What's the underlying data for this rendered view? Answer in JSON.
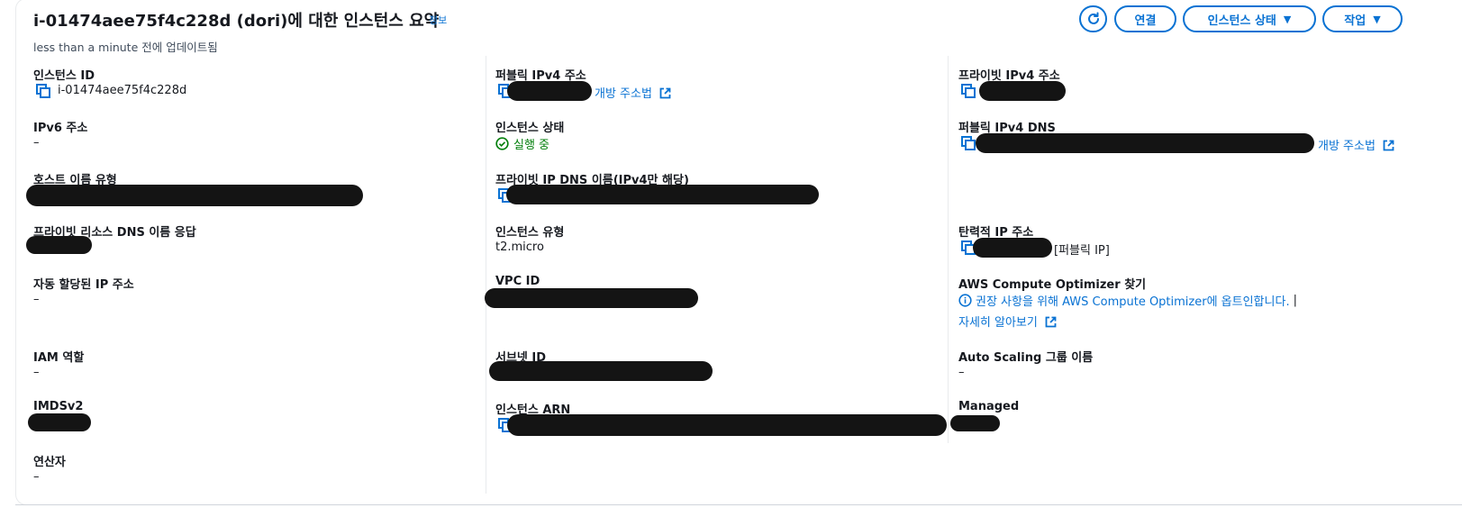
{
  "header": {
    "title": "i-01474aee75f4c228d (dori)에 대한 인스턴스 요약",
    "info_link": "정보",
    "updated": "less than a minute 전에 업데이트됨",
    "buttons": {
      "connect": "연결",
      "instance_state": "인스턴스 상태",
      "actions": "작업"
    }
  },
  "col1": {
    "instance_id": {
      "label": "인스턴스 ID",
      "value": "i-01474aee75f4c228d"
    },
    "ipv6": {
      "label": "IPv6 주소",
      "value": "–"
    },
    "hostname_type": {
      "label": "호스트 이름 유형"
    },
    "private_dns_answer": {
      "label": "프라이빗 리소스 DNS 이름 응답"
    },
    "auto_ip": {
      "label": "자동 할당된 IP 주소",
      "value": "–"
    },
    "iam_role": {
      "label": "IAM 역할",
      "value": "–"
    },
    "imdsv2": {
      "label": "IMDSv2"
    },
    "operator": {
      "label": "연산자",
      "value": "–"
    }
  },
  "col2": {
    "public_ipv4": {
      "label": "퍼블릭 IPv4 주소",
      "link": "개방 주소법"
    },
    "instance_state": {
      "label": "인스턴스 상태",
      "value": "실행 중"
    },
    "private_ip_dns": {
      "label": "프라이빗 IP DNS 이름(IPv4만 해당)"
    },
    "instance_type": {
      "label": "인스턴스 유형",
      "value": "t2.micro"
    },
    "vpc_id": {
      "label": "VPC ID"
    },
    "subnet_id": {
      "label": "서브넷 ID"
    },
    "instance_arn": {
      "label": "인스턴스 ARN"
    }
  },
  "col3": {
    "private_ipv4": {
      "label": "프라이빗 IPv4 주소"
    },
    "public_ipv4_dns": {
      "label": "퍼블릭 IPv4 DNS",
      "link": "개방 주소법"
    },
    "elastic_ip": {
      "label": "탄력적 IP 주소",
      "suffix": "[퍼블릭 IP]"
    },
    "compute_optimizer": {
      "label": "AWS Compute Optimizer 찾기",
      "message": "권장 사항을 위해 AWS Compute Optimizer에 옵트인합니다.",
      "separator": "|",
      "learn_more": "자세히 알아보기"
    },
    "asg_name": {
      "label": "Auto Scaling 그룹 이름",
      "value": "–"
    },
    "managed": {
      "label": "Managed"
    }
  },
  "colors": {
    "link": "#0972d3",
    "success": "#037f0c",
    "text": "#16191f",
    "redaction": "#141414"
  }
}
